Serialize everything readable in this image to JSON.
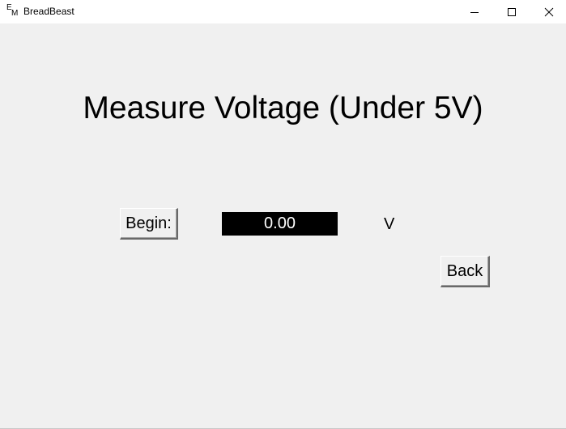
{
  "window": {
    "title": "BreadBeast",
    "icon_top": "E",
    "icon_bottom": "M",
    "controls": [
      "minimize-icon",
      "maximize-icon",
      "close-icon"
    ]
  },
  "main": {
    "heading": "Measure Voltage (Under 5V)",
    "begin_label": "Begin:",
    "reading": "0.00",
    "unit": "V",
    "back_label": "Back"
  },
  "colors": {
    "background": "#f0f0f0",
    "readout_bg": "#000000",
    "readout_fg": "#ffffff"
  }
}
